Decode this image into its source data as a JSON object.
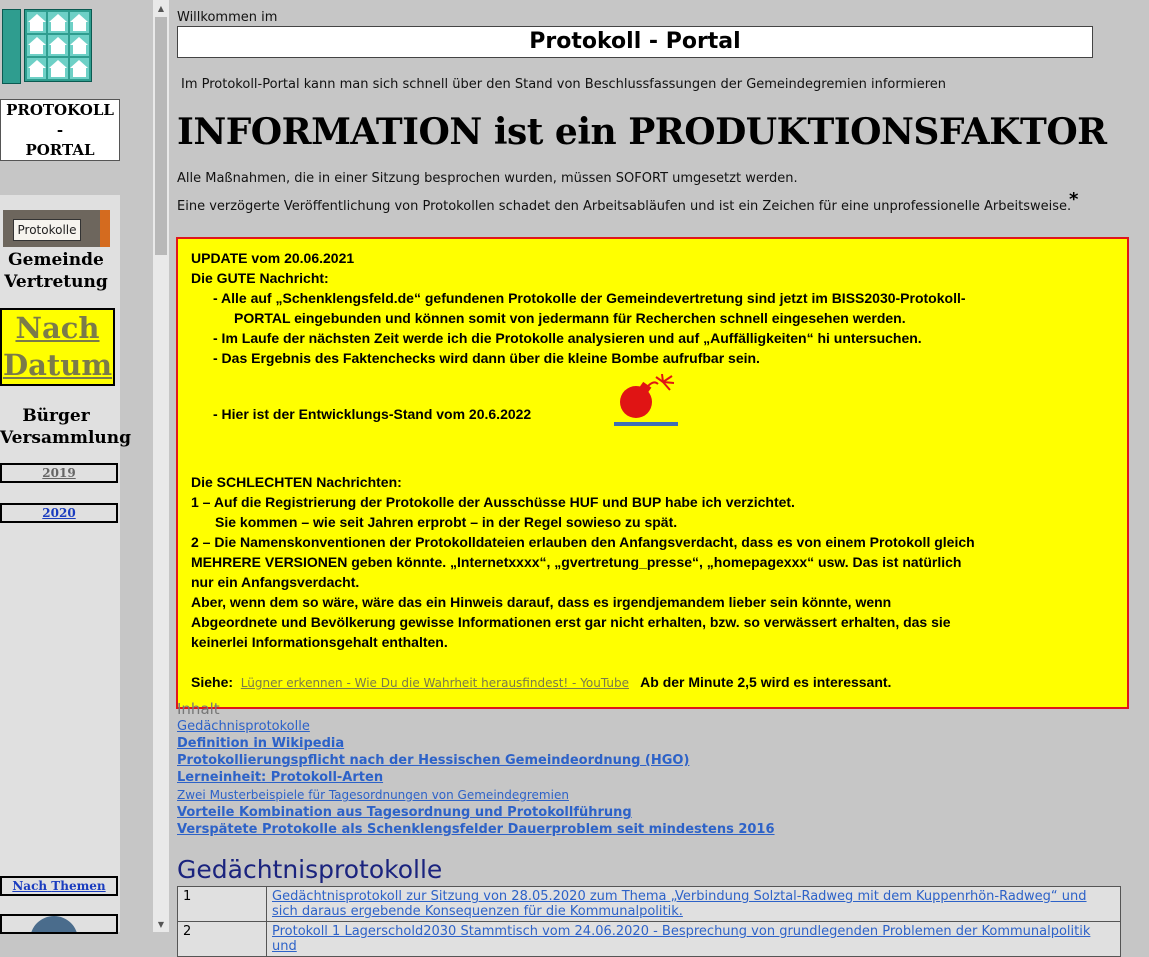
{
  "sidebar": {
    "portal_line1": "PROTOKOLL",
    "portal_line2": "-",
    "portal_line3": "PORTAL",
    "protokolle_label": "Protokolle",
    "gemeinde_line1": "Gemeinde",
    "gemeinde_line2": "Vertretung",
    "nach_line1": "Nach",
    "nach_line2": "Datum",
    "buerger_line1": "Bürger",
    "buerger_line2": "Versammlung",
    "year1": "2019",
    "year2": "2020",
    "themen_1": "Nach",
    "themen_2": "Themen"
  },
  "header": {
    "welcome": "Willkommen im",
    "title": "Protokoll - Portal",
    "intro": "Im Protokoll-Portal kann man sich schnell über den Stand von Beschlussfassungen der Gemeindegremien informieren",
    "big_heading": "INFORMATION ist ein PRODUKTIONSFAKTOR",
    "line1": "Alle Maßnahmen, die in einer Sitzung besprochen wurden, müssen SOFORT umgesetzt werden.",
    "line2": "Eine verzögerte Veröffentlichung von Protokollen schadet den Arbeitsabläufen und ist ein Zeichen für eine unprofessionelle Arbeitsweise.",
    "star": "*"
  },
  "update": {
    "l1": "UPDATE vom 20.06.2021",
    "l2": "Die GUTE Nachricht:",
    "l3": "-    Alle auf „Schenklengsfeld.de“ gefundenen Protokolle der Gemeindevertretung sind jetzt im BISS2030-Protokoll-",
    "l4": "PORTAL eingebunden und können somit von jedermann für Recherchen schnell eingesehen werden.",
    "l5": "-    Im Laufe der nächsten Zeit werde ich die Protokolle analysieren und auf „Auffälligkeiten“ hi untersuchen.",
    "l6": "-    Das Ergebnis des Faktenchecks wird dann über die kleine Bombe aufrufbar sein.",
    "l7": "-    Hier ist der Entwicklungs-Stand vom 20.6.2022",
    "l8": "Die SCHLECHTEN Nachrichten:",
    "l9": "1 – Auf die Registrierung der Protokolle der Ausschüsse HUF und BUP habe ich verzichtet.",
    "l10": "Sie kommen – wie seit Jahren erprobt – in der Regel sowieso zu spät.",
    "l11": "2 – Die Namenskonventionen der Protokolldateien erlauben den Anfangsverdacht, dass es von einem Protokoll gleich",
    "l12": "MEHRERE VERSIONEN geben könnte. „Internetxxxx“, „gvertretung_presse“, „homepagexxx“ usw.  Das ist natürlich",
    "l13": "nur ein Anfangsverdacht.",
    "l14": "Aber, wenn dem so wäre, wäre das ein Hinweis darauf, dass es irgendjemandem lieber sein könnte, wenn",
    "l15": "Abgeordnete und Bevölkerung gewisse Informationen erst gar nicht erhalten, bzw. so verwässert erhalten, das sie",
    "l16": "keinerlei Informationsgehalt enthalten.",
    "siehe": "Siehe:",
    "link": "Lügner erkennen - Wie Du die Wahrheit herausfindest! - YouTube",
    "after_link": "Ab der Minute 2,5 wird es interessant."
  },
  "toc": {
    "inhalt": "Inhalt",
    "items": [
      "Gedächnisprotokolle",
      "Definition in Wikipedia",
      "Protokollierungspflicht nach der Hessischen Gemeindeordnung (HGO)",
      "Lerneinheit: Protokoll-Arten",
      "Zwei Musterbeispiele für Tagesordnungen von Gemeindegremien",
      "Vorteile Kombination aus Tagesordnung und Protokollführung",
      "Verspätete Protokolle als Schenklengsfelder Dauerproblem seit mindestens 2016"
    ]
  },
  "gedaechtnis": {
    "heading": "Gedächtnisprotokolle",
    "rows": [
      {
        "num": "1",
        "text": "Gedächtnisprotokoll zur Sitzung von 28.05.2020 zum Thema „Verbindung Solztal-Radweg mit dem Kuppenrhön-Radweg“ und sich daraus ergebende Konsequenzen für die Kommunalpolitik."
      },
      {
        "num": "2",
        "text": "Protokoll 1 Lagerschold2030 Stammtisch vom 24.06.2020 - Besprechung von grundlegenden Problemen der Kommunalpolitik und"
      }
    ]
  }
}
